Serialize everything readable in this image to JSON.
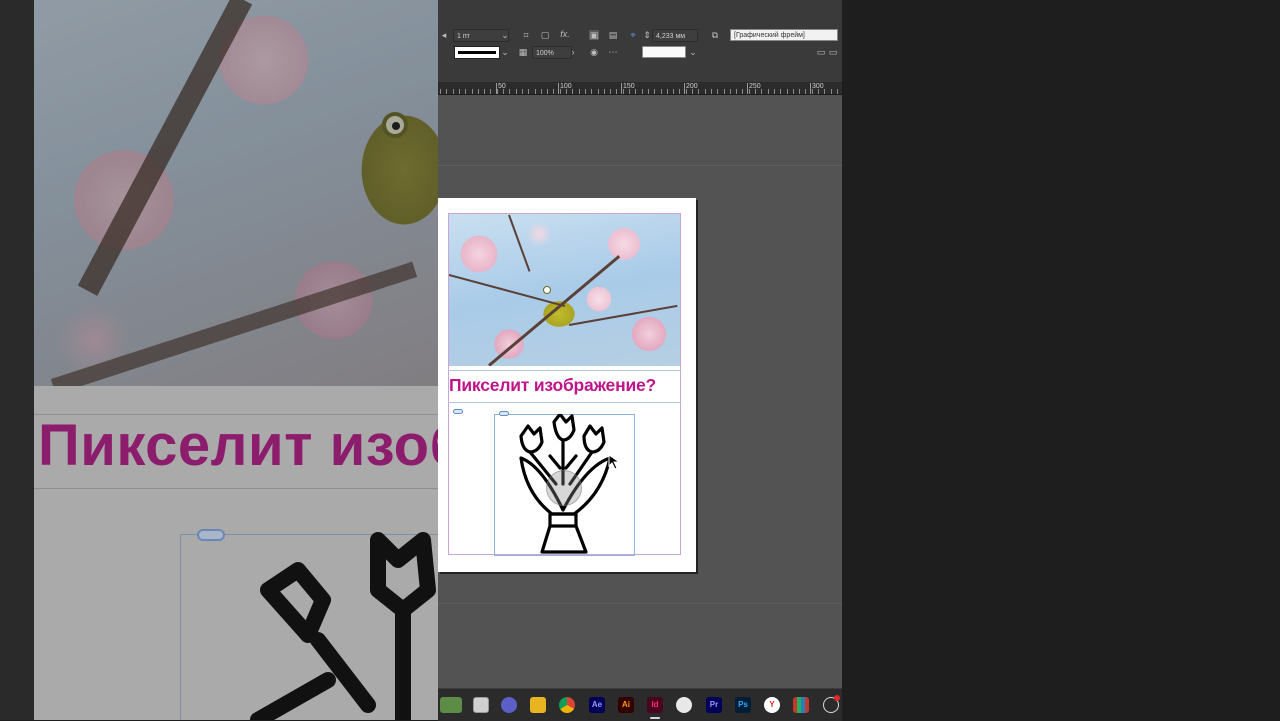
{
  "control_bar": {
    "stroke_weight": "1 пт",
    "opacity": "100%",
    "fx_label": "fx.",
    "offset_value": "4,233 мм",
    "object_style": "[Графический фрейм]"
  },
  "ruler": {
    "labels": [
      "50",
      "100",
      "150",
      "200",
      "250",
      "300"
    ]
  },
  "document": {
    "heading": "Пикселит изображение?",
    "zoomed_heading": "Пикселит изоб"
  },
  "taskbar": {
    "apps": [
      {
        "name": "explorer",
        "label": ""
      },
      {
        "name": "window",
        "label": ""
      },
      {
        "name": "chat",
        "label": ""
      },
      {
        "name": "folder",
        "label": ""
      },
      {
        "name": "chrome",
        "label": ""
      },
      {
        "name": "after-effects",
        "label": "Ae"
      },
      {
        "name": "illustrator",
        "label": "Ai"
      },
      {
        "name": "indesign",
        "label": "Id"
      },
      {
        "name": "pen",
        "label": ""
      },
      {
        "name": "premiere",
        "label": "Pr"
      },
      {
        "name": "photoshop",
        "label": "Ps"
      },
      {
        "name": "yandex",
        "label": "Y"
      },
      {
        "name": "archive",
        "label": ""
      },
      {
        "name": "settings",
        "label": ""
      }
    ]
  },
  "colors": {
    "heading": "#c0158a",
    "indesign": "#49021f",
    "photoshop": "#001e36",
    "illustrator": "#330000",
    "premiere": "#00005b",
    "after_effects": "#00005b"
  }
}
